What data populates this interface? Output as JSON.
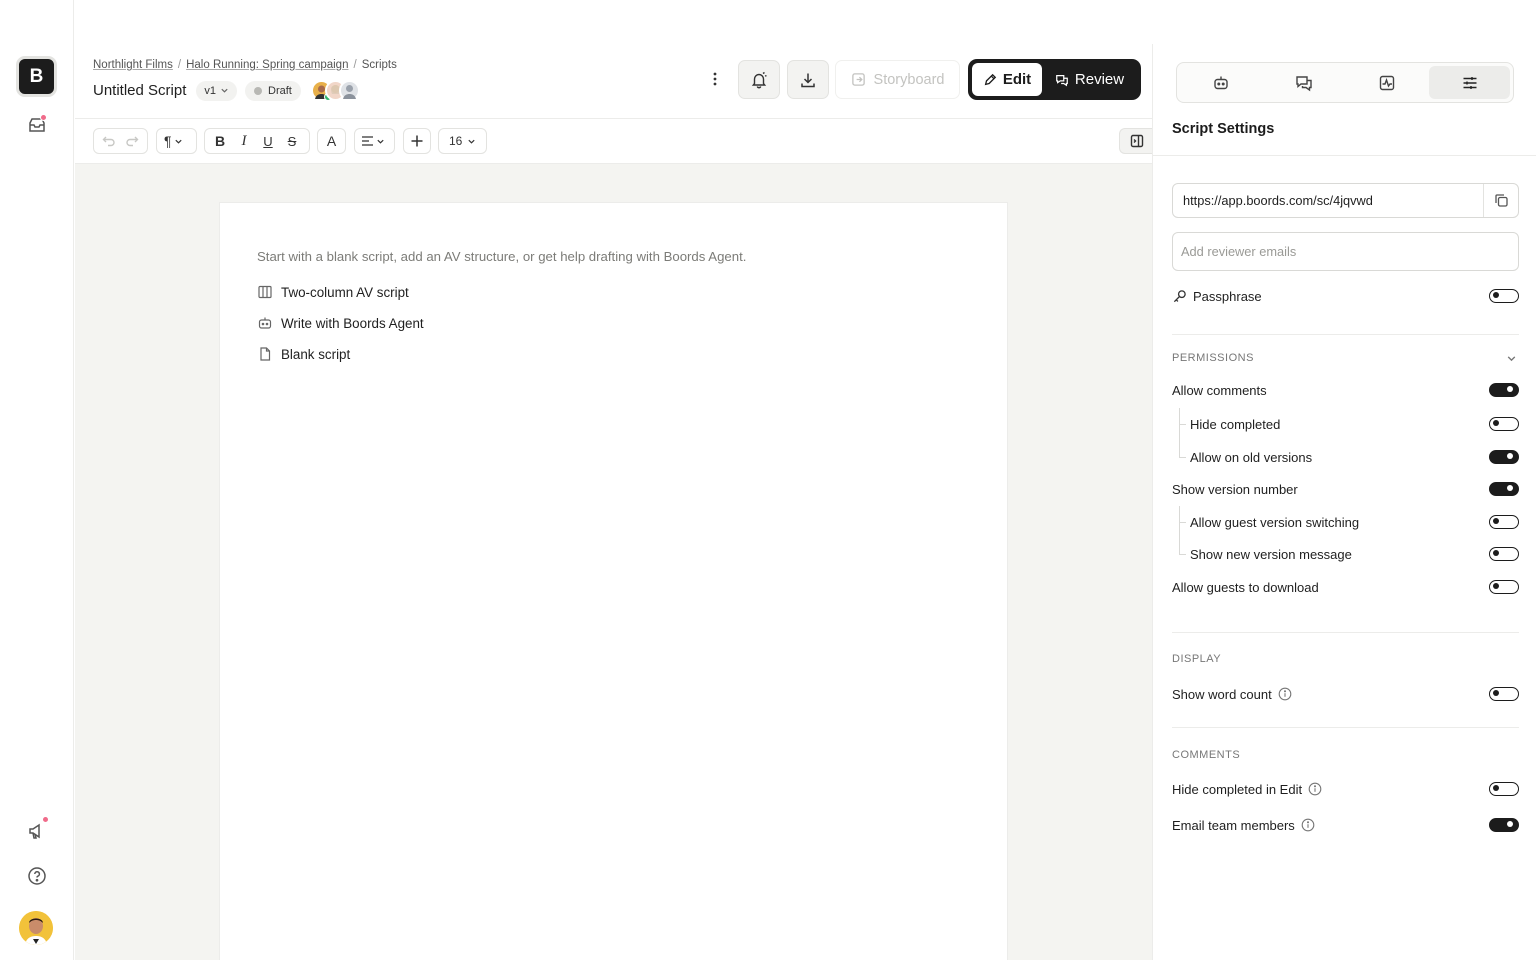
{
  "app": {
    "logo_letter": "B",
    "colors": {
      "accent": "#1c1c1c",
      "notification": "#f06b8a",
      "online": "#2fb36b",
      "canvas_bg": "#f4f4f1"
    }
  },
  "rail": {
    "top_icons": [
      "inbox-icon"
    ],
    "bottom_icons": [
      "megaphone-icon",
      "help-icon",
      "user-avatar"
    ]
  },
  "header": {
    "breadcrumbs": [
      {
        "label": "Northlight Films"
      },
      {
        "label": "Halo Running: Spring campaign"
      },
      {
        "label": "Scripts"
      }
    ],
    "title": "Untitled Script",
    "version": "v1",
    "status": "Draft",
    "storyboard_label": "Storyboard",
    "edit_label": "Edit",
    "review_label": "Review"
  },
  "toolbar": {
    "font_size": "16"
  },
  "editor": {
    "hint": "Start with a blank script, add an AV structure, or get help drafting with Boords Agent.",
    "options": [
      {
        "label": "Two-column AV script",
        "icon": "columns-icon"
      },
      {
        "label": "Write with Boords Agent",
        "icon": "agent-icon"
      },
      {
        "label": "Blank script",
        "icon": "document-icon"
      }
    ]
  },
  "panel": {
    "tabs": [
      "agent-icon",
      "comments-icon",
      "activity-icon",
      "sliders-icon"
    ],
    "active_tab": 3,
    "title": "Script Settings",
    "share_url": "https://app.boords.com/sc/4jqvwd",
    "reviewer_placeholder": "Add reviewer emails",
    "passphrase": {
      "label": "Passphrase",
      "on": false
    },
    "permissions": {
      "heading": "PERMISSIONS",
      "allow_comments": {
        "label": "Allow comments",
        "on": true
      },
      "hide_completed": {
        "label": "Hide completed",
        "on": false
      },
      "allow_old_versions": {
        "label": "Allow on old versions",
        "on": true
      },
      "show_version_number": {
        "label": "Show version number",
        "on": true
      },
      "guest_version_switching": {
        "label": "Allow guest version switching",
        "on": false
      },
      "new_version_message": {
        "label": "Show new version message",
        "on": false
      },
      "guests_download": {
        "label": "Allow guests to download",
        "on": false
      }
    },
    "display": {
      "heading": "DISPLAY",
      "word_count": {
        "label": "Show word count",
        "on": false
      }
    },
    "comments": {
      "heading": "COMMENTS",
      "hide_completed_edit": {
        "label": "Hide completed in Edit",
        "on": false
      },
      "email_team": {
        "label": "Email team members",
        "on": true
      }
    }
  }
}
